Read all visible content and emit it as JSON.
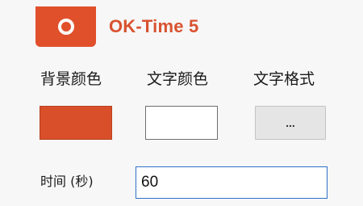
{
  "header": {
    "app_icon": "circle-logo-icon",
    "title": "OK-Time 5",
    "accent_color": "#d9522f"
  },
  "settings": {
    "background_color_label": "背景颜色",
    "background_color_value": "#d84f29",
    "text_color_label": "文字颜色",
    "text_color_value": "#ffffff",
    "text_format_label": "文字格式",
    "text_format_button": "...",
    "time_label": "时间 (秒)",
    "time_value": "60"
  }
}
